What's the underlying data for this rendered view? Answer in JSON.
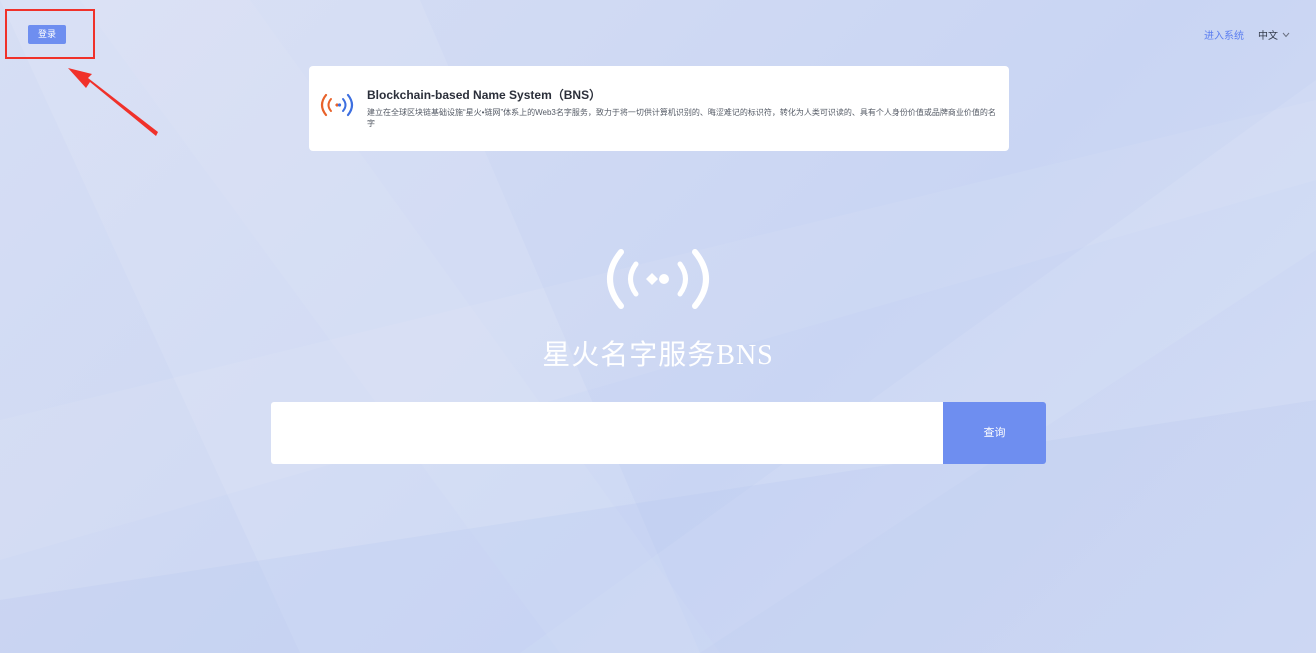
{
  "header": {
    "login_label": "登录",
    "enter_system_label": "进入系统",
    "language_label": "中文"
  },
  "info_card": {
    "title": "Blockchain-based Name System（BNS）",
    "description": "建立在全球区块链基础设施“星火•链网”体系上的Web3名字服务，致力于将一切供计算机识别的、晦涩难记的标识符，转化为人类可识读的、具有个人身份价值或品牌商业价值的名字"
  },
  "hero": {
    "title_cn": "星火名字服务",
    "title_latin": "BNS"
  },
  "search": {
    "placeholder": "",
    "value": "",
    "button_label": "查询"
  },
  "colors": {
    "accent": "#6e8ef0",
    "link": "#5b7ef0",
    "annotation_red": "#f0312a",
    "logo_orange": "#e8622a",
    "logo_blue": "#3d6fe0"
  },
  "icons": {
    "brand": "signal-waves-icon",
    "dropdown": "chevron-down-icon",
    "annotation": "red-arrow-icon"
  }
}
